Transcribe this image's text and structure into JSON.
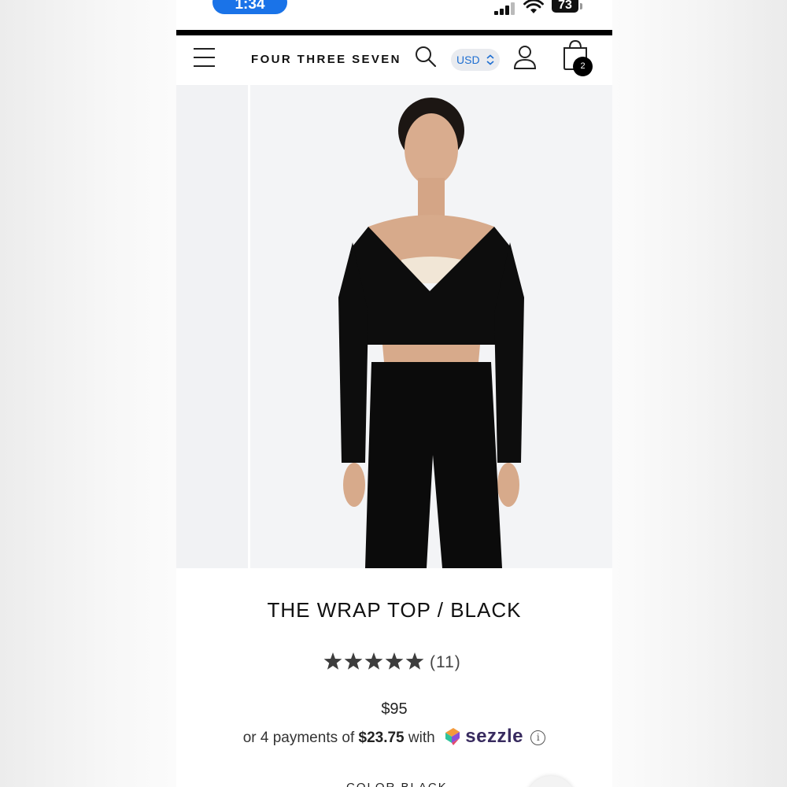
{
  "status_bar": {
    "time": "1:34",
    "battery": "73"
  },
  "header": {
    "brand": "FOUR THREE SEVEN",
    "currency": "USD",
    "cart_count": "2"
  },
  "product": {
    "title": "THE WRAP TOP / BLACK",
    "rating": 5,
    "review_count": "(11)",
    "price": "$95",
    "installments": {
      "prefix": "or 4 payments of",
      "amount": "$23.75",
      "connector": "with",
      "provider": "sezzle",
      "info_symbol": "i"
    },
    "color_label": "COLOR BLACK"
  },
  "colors": {
    "time_pill": "#1a73e8",
    "currency_text": "#1f6fd1",
    "sezzle_text": "#382b5f",
    "star": "#3d3d3d"
  }
}
